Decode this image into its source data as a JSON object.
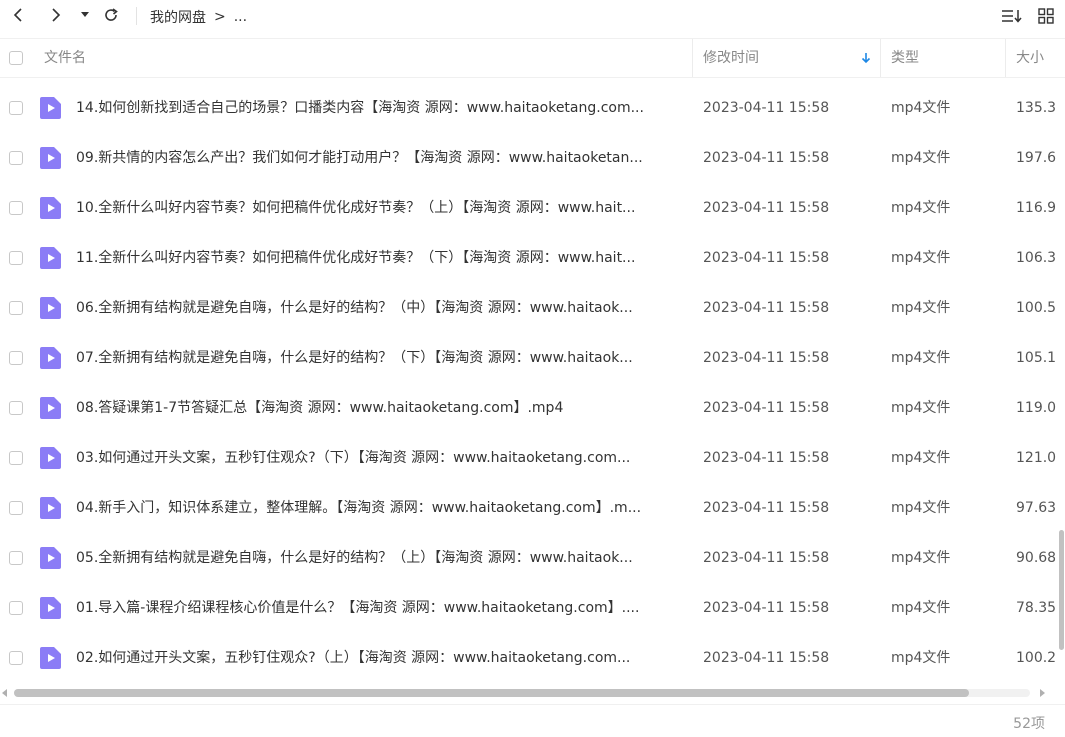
{
  "toolbar": {
    "breadcrumb": [
      "我的网盘",
      ">",
      "..."
    ]
  },
  "header": {
    "name": "文件名",
    "modified": "修改时间",
    "type": "类型",
    "size": "大小"
  },
  "icons": {
    "back": "chevron-left-icon",
    "forward": "chevron-right-icon",
    "history": "caret-down-icon",
    "refresh": "refresh-icon",
    "sort": "sort-list-icon",
    "grid": "grid-view-icon",
    "file": "video-file-icon",
    "sort_dir": "arrow-down-icon"
  },
  "colors": {
    "file_icon": "#8b7cf6",
    "sort_arrow": "#1e88e5"
  },
  "files": [
    {
      "name": "14.如何创新找到适合自己的场景？口播类内容【海淘资 源网：www.haitaoketang.com...",
      "date": "2023-04-11 15:58",
      "type": "mp4文件",
      "size": "135.3"
    },
    {
      "name": "09.新共情的内容怎么产出？我们如何才能打动用户？【海淘资 源网：www.haitaoketan...",
      "date": "2023-04-11 15:58",
      "type": "mp4文件",
      "size": "197.6"
    },
    {
      "name": "10.全新什么叫好内容节奏？如何把稿件优化成好节奏？（上）【海淘资 源网：www.hait...",
      "date": "2023-04-11 15:58",
      "type": "mp4文件",
      "size": "116.9"
    },
    {
      "name": "11.全新什么叫好内容节奏？如何把稿件优化成好节奏？（下）【海淘资 源网：www.hait...",
      "date": "2023-04-11 15:58",
      "type": "mp4文件",
      "size": "106.3"
    },
    {
      "name": "06.全新拥有结构就是避免自嗨，什么是好的结构？（中）【海淘资 源网：www.haitaok...",
      "date": "2023-04-11 15:58",
      "type": "mp4文件",
      "size": "100.5"
    },
    {
      "name": "07.全新拥有结构就是避免自嗨，什么是好的结构？（下）【海淘资 源网：www.haitaok...",
      "date": "2023-04-11 15:58",
      "type": "mp4文件",
      "size": "105.1"
    },
    {
      "name": "08.答疑课第1-7节答疑汇总【海淘资 源网：www.haitaoketang.com】.mp4",
      "date": "2023-04-11 15:58",
      "type": "mp4文件",
      "size": "119.0"
    },
    {
      "name": "03.如何通过开头文案，五秒钉住观众?（下）【海淘资 源网：www.haitaoketang.com...",
      "date": "2023-04-11 15:58",
      "type": "mp4文件",
      "size": "121.0"
    },
    {
      "name": "04.新手入门，知识体系建立，整体理解。【海淘资 源网：www.haitaoketang.com】.m...",
      "date": "2023-04-11 15:58",
      "type": "mp4文件",
      "size": "97.63"
    },
    {
      "name": "05.全新拥有结构就是避免自嗨，什么是好的结构？（上）【海淘资 源网：www.haitaok...",
      "date": "2023-04-11 15:58",
      "type": "mp4文件",
      "size": "90.68"
    },
    {
      "name": "01.导入篇-课程介绍课程核心价值是什么？【海淘资 源网：www.haitaoketang.com】....",
      "date": "2023-04-11 15:58",
      "type": "mp4文件",
      "size": "78.35"
    },
    {
      "name": "02.如何通过开头文案，五秒钉住观众?（上）【海淘资 源网：www.haitaoketang.com...",
      "date": "2023-04-11 15:58",
      "type": "mp4文件",
      "size": "100.2"
    }
  ],
  "footer": {
    "count": "52项"
  }
}
